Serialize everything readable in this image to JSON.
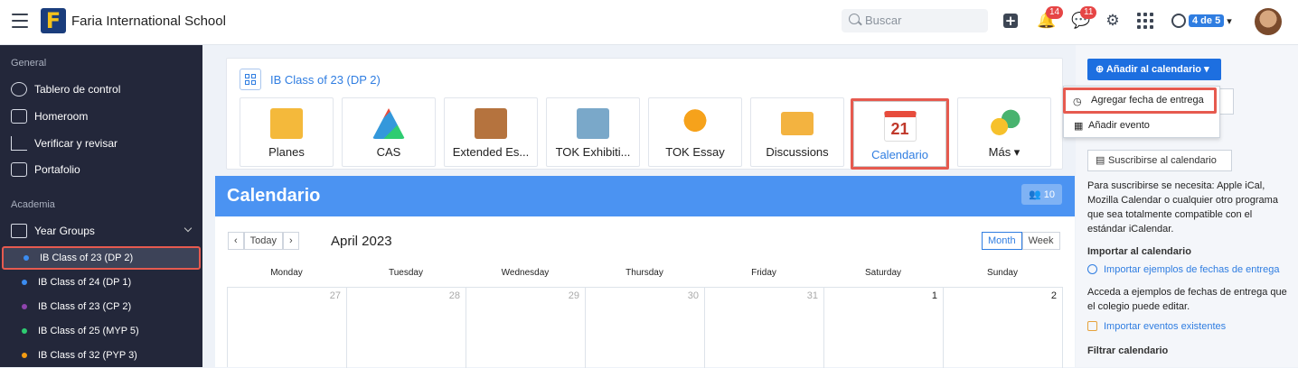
{
  "topbar": {
    "school": "Faria International School",
    "search_placeholder": "Buscar",
    "notif_count": "14",
    "chat_count": "11",
    "pager": "4 de 5"
  },
  "sidebar": {
    "section_general": "General",
    "items": [
      {
        "label": "Tablero de control"
      },
      {
        "label": "Homeroom"
      },
      {
        "label": "Verificar y revisar"
      },
      {
        "label": "Portafolio"
      }
    ],
    "section_academia": "Academia",
    "year_groups": "Year Groups",
    "groups": [
      {
        "label": "IB Class of 23 (DP 2)",
        "color": "#3b8cf0"
      },
      {
        "label": "IB Class of 24 (DP 1)",
        "color": "#3b8cf0"
      },
      {
        "label": "IB Class of 23 (CP 2)",
        "color": "#8e44ad"
      },
      {
        "label": "IB Class of 25 (MYP 5)",
        "color": "#2ecc71"
      },
      {
        "label": "IB Class of 32 (PYP 3)",
        "color": "#f39c12"
      }
    ]
  },
  "main": {
    "class_title": "IB Class of 23 (DP 2)",
    "tiles": [
      {
        "label": "Planes"
      },
      {
        "label": "CAS"
      },
      {
        "label": "Extended Es..."
      },
      {
        "label": "TOK Exhibiti..."
      },
      {
        "label": "TOK Essay"
      },
      {
        "label": "Discussions"
      },
      {
        "label": "Calendario"
      },
      {
        "label": "Más ▾"
      }
    ]
  },
  "calendar": {
    "title": "Calendario",
    "members": "10",
    "today": "Today",
    "month": "April 2023",
    "views": [
      "Month",
      "Week"
    ],
    "days": [
      "Monday",
      "Tuesday",
      "Wednesday",
      "Thursday",
      "Friday",
      "Saturday",
      "Sunday"
    ],
    "dates": [
      "27",
      "28",
      "29",
      "30",
      "31",
      "1",
      "2"
    ]
  },
  "right": {
    "add_button": "Añadir al calendario",
    "menu_due": "Agregar fecha de entrega",
    "menu_event": "Añadir evento",
    "subscribe": "Suscribirse al calendario",
    "subscribe_text": "Para suscribirse se necesita: Apple iCal, Mozilla Calendar o cualquier otro programa que sea totalmente compatible con el estándar iCalendar.",
    "import_head": "Importar al calendario",
    "import_link": "Importar ejemplos de fechas de entrega",
    "import_text": "Acceda a ejemplos de fechas de entrega que el colegio puede editar.",
    "import_events": "Importar eventos existentes",
    "filter_head": "Filtrar calendario"
  }
}
